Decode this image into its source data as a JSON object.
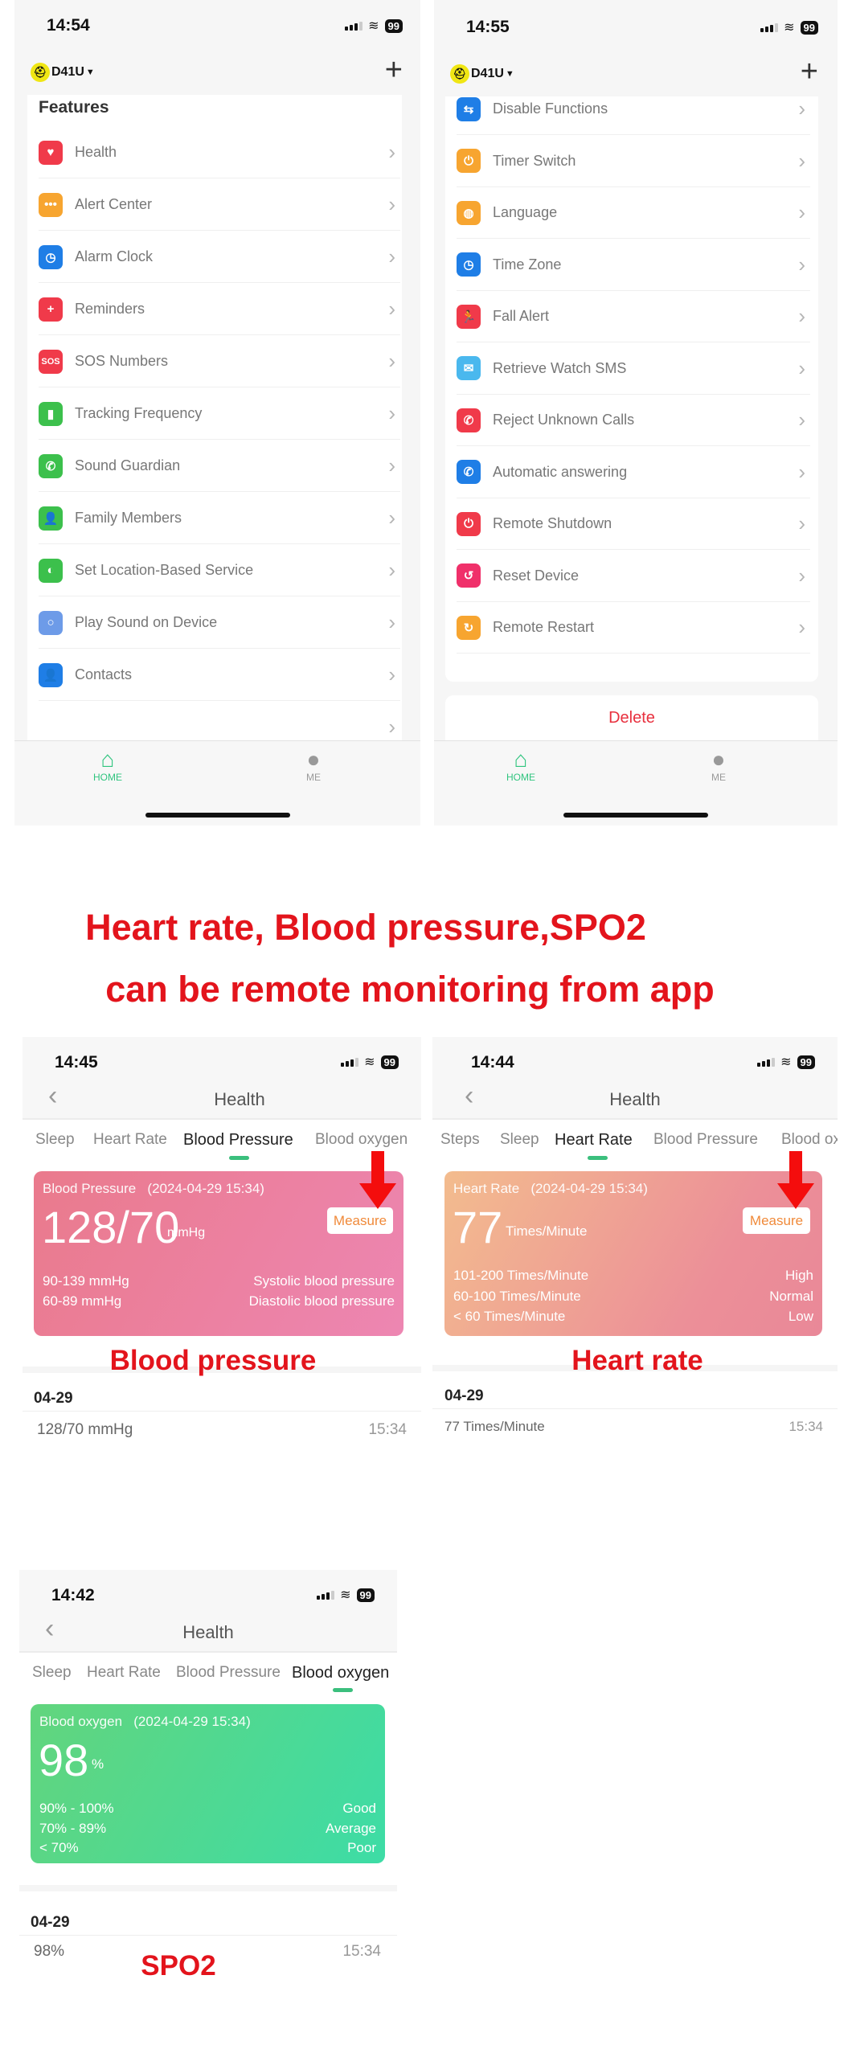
{
  "status": {
    "battery": "99"
  },
  "screens": {
    "features": {
      "time": "14:54",
      "device": "D41U",
      "title": "Features",
      "items": [
        {
          "label": "Health",
          "icon": "heart-icon",
          "color": "#f03a4a",
          "glyph": "♥"
        },
        {
          "label": "Alert Center",
          "icon": "message-dots-icon",
          "color": "#f7a530",
          "glyph": "•••"
        },
        {
          "label": "Alarm Clock",
          "icon": "alarm-clock-icon",
          "color": "#1f7ee6",
          "glyph": "◷"
        },
        {
          "label": "Reminders",
          "icon": "medical-kit-icon",
          "color": "#f03a4a",
          "glyph": "+"
        },
        {
          "label": "SOS Numbers",
          "icon": "sos-icon",
          "color": "#f03a4a",
          "glyph": "SOS"
        },
        {
          "label": "Tracking Frequency",
          "icon": "tracking-icon",
          "color": "#3cc04c",
          "glyph": "▮"
        },
        {
          "label": "Sound Guardian",
          "icon": "shield-phone-icon",
          "color": "#3cc04c",
          "glyph": "✆"
        },
        {
          "label": "Family Members",
          "icon": "family-icon",
          "color": "#3cc04c",
          "glyph": "👤"
        },
        {
          "label": "Set Location-Based Service",
          "icon": "toggle-icon",
          "color": "#3cc04c",
          "glyph": "◐"
        },
        {
          "label": "Play Sound on Device",
          "icon": "search-sound-icon",
          "color": "#6d9be8",
          "glyph": "○"
        },
        {
          "label": "Contacts",
          "icon": "contacts-icon",
          "color": "#1f7ee6",
          "glyph": "👤"
        },
        {
          "label": "",
          "icon": "",
          "color": "#ffffff",
          "glyph": ""
        }
      ]
    },
    "settings": {
      "time": "14:55",
      "device": "D41U",
      "delete": "Delete",
      "items": [
        {
          "label": "Disable Functions",
          "icon": "switches-icon",
          "color": "#1f7ee6",
          "glyph": "⇆"
        },
        {
          "label": "Timer Switch",
          "icon": "timer-power-icon",
          "color": "#f7a530",
          "glyph": "⏻"
        },
        {
          "label": "Language",
          "icon": "globe-icon",
          "color": "#f7a530",
          "glyph": "◍"
        },
        {
          "label": "Time Zone",
          "icon": "clock-icon",
          "color": "#1f7ee6",
          "glyph": "◷"
        },
        {
          "label": "Fall Alert",
          "icon": "fall-person-icon",
          "color": "#f03a4a",
          "glyph": "🏃"
        },
        {
          "label": "Retrieve Watch SMS",
          "icon": "envelope-icon",
          "color": "#4ab8ee",
          "glyph": "✉"
        },
        {
          "label": "Reject Unknown Calls",
          "icon": "reject-call-icon",
          "color": "#f03a4a",
          "glyph": "✆"
        },
        {
          "label": "Automatic answering",
          "icon": "auto-answer-icon",
          "color": "#1f7ee6",
          "glyph": "✆"
        },
        {
          "label": "Remote Shutdown",
          "icon": "power-icon",
          "color": "#f03a4a",
          "glyph": "⏻"
        },
        {
          "label": "Reset Device",
          "icon": "reset-icon",
          "color": "#f0306a",
          "glyph": "↺"
        },
        {
          "label": "Remote Restart",
          "icon": "watch-restart-icon",
          "color": "#f7a530",
          "glyph": "↻"
        }
      ]
    },
    "tabbar": {
      "home": "HOME",
      "me": "ME",
      "active_color": "#2fc47e"
    }
  },
  "headline": {
    "line1": "Heart rate, Blood pressure,SPO2",
    "line2": "can be remote monitoring from app"
  },
  "health": {
    "title": "Health",
    "measure": "Measure",
    "bp": {
      "time": "14:45",
      "tabs": [
        "Sleep",
        "Heart Rate",
        "Blood Pressure",
        "Blood oxygen"
      ],
      "active": "Blood Pressure",
      "label": "Blood Pressure",
      "stamp": "(2024-04-29 15:34)",
      "value": "128/70",
      "unit": "mmHg",
      "ranges": [
        {
          "range": "90-139 mmHg",
          "desc": "Systolic blood pressure"
        },
        {
          "range": "60-89 mmHg",
          "desc": "Diastolic blood pressure"
        }
      ],
      "annotation": "Blood pressure",
      "date": "04-29",
      "record": "128/70 mmHg",
      "record_time": "15:34"
    },
    "hr": {
      "time": "14:44",
      "tabs": [
        "Steps",
        "Sleep",
        "Heart Rate",
        "Blood Pressure",
        "Blood oxygen"
      ],
      "active": "Heart Rate",
      "label": "Heart Rate",
      "stamp": "(2024-04-29 15:34)",
      "value": "77",
      "unit": "Times/Minute",
      "ranges": [
        {
          "range": "101-200 Times/Minute",
          "desc": "High"
        },
        {
          "range": "60-100 Times/Minute",
          "desc": "Normal"
        },
        {
          "range": "< 60 Times/Minute",
          "desc": "Low"
        }
      ],
      "annotation": "Heart rate",
      "date": "04-29",
      "record": "77 Times/Minute",
      "record_time": "15:34"
    },
    "spo2": {
      "time": "14:42",
      "tabs": [
        "Sleep",
        "Heart Rate",
        "Blood Pressure",
        "Blood oxygen"
      ],
      "active": "Blood oxygen",
      "label": "Blood oxygen",
      "stamp": "(2024-04-29 15:34)",
      "value": "98",
      "unit": "%",
      "ranges": [
        {
          "range": "90% - 100%",
          "desc": "Good"
        },
        {
          "range": "70% - 89%",
          "desc": "Average"
        },
        {
          "range": "< 70%",
          "desc": "Poor"
        }
      ],
      "annotation": "SPO2",
      "date": "04-29",
      "record": "98%",
      "record_time": "15:34"
    }
  }
}
